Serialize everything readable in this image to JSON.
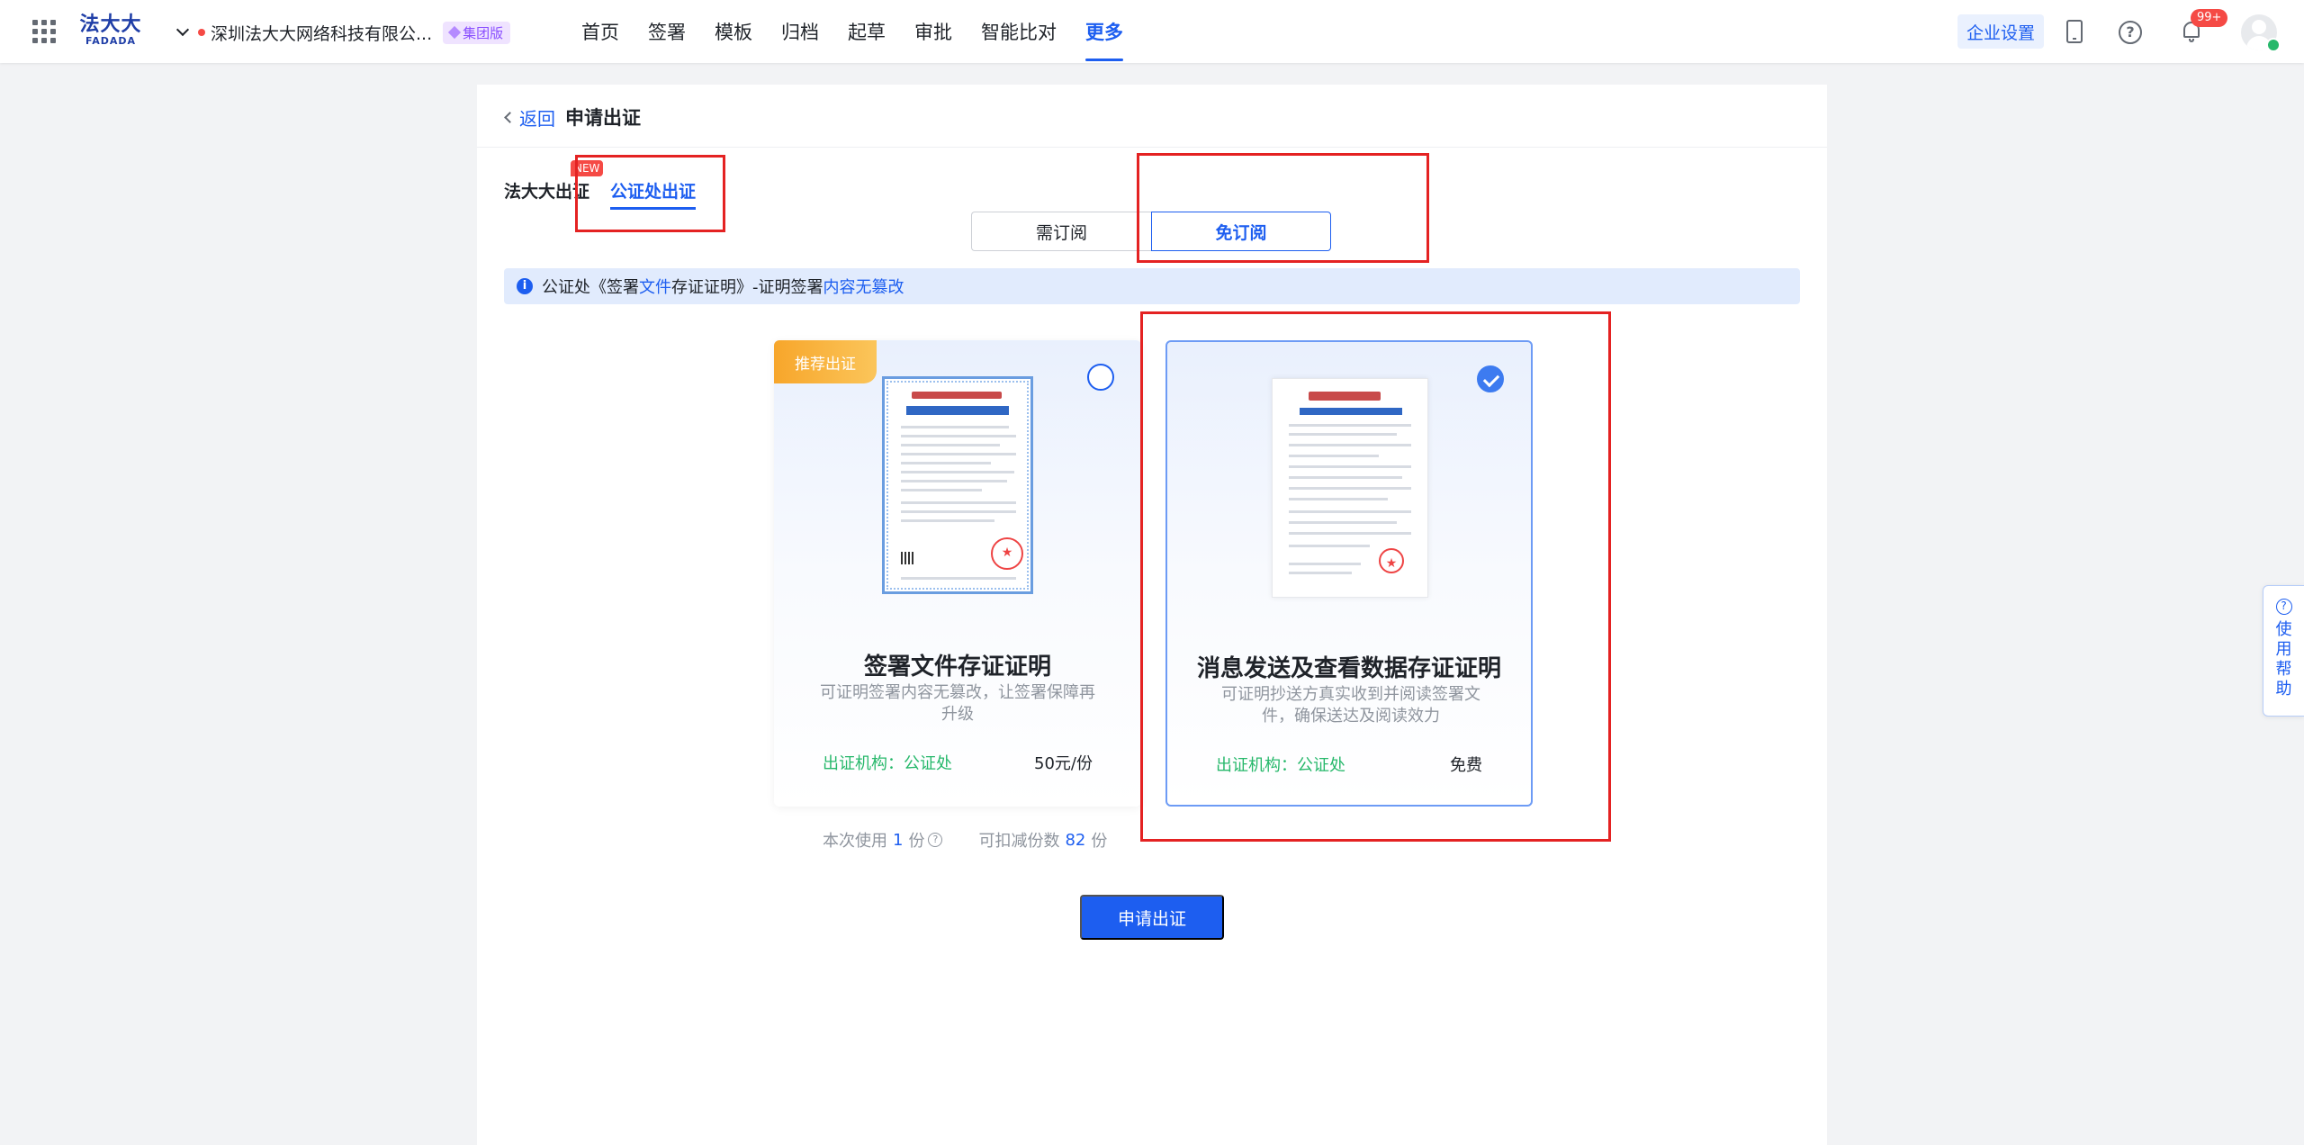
{
  "topbar": {
    "logo_cn": "法大大",
    "logo_en": "FADADA",
    "company": "深圳法大大网络科技有限公...",
    "edition_badge": "集团版",
    "nav": [
      "首页",
      "签署",
      "模板",
      "归档",
      "起草",
      "审批",
      "智能比对",
      "更多"
    ],
    "active_nav": "更多",
    "enterprise_settings": "企业设置",
    "bell_count": "99+",
    "help_glyph": "?"
  },
  "page": {
    "back": "返回",
    "title": "申请出证",
    "tabs": {
      "fadada": "法大大出证",
      "new_badge": "NEW",
      "notary": "公证处出证"
    },
    "subscription": {
      "need": "需订阅",
      "free": "免订阅"
    },
    "info": {
      "icon": "i",
      "prefix": "公证处《签署",
      "hl1": "文件",
      "mid": "存证证明》-证明签署",
      "hl2": "内容无篡改"
    },
    "cards": [
      {
        "tag": "推荐出证",
        "title": "签署文件存证证明",
        "desc": "可证明签署内容无篡改，让签署保障再升级",
        "org": "出证机构：公证处",
        "price": "50元/份",
        "selected": false
      },
      {
        "title": "消息发送及查看数据存证证明",
        "desc": "可证明抄送方真实收到并阅读签署文件，确保送达及阅读效力",
        "org": "出证机构：公证处",
        "price": "免费",
        "selected": true
      }
    ],
    "usage": {
      "label1": "本次使用",
      "count1": "1",
      "unit1": "份",
      "q": "?",
      "label2": "可扣减份数",
      "count2": "82",
      "unit2": "份"
    },
    "submit": "申请出证"
  },
  "help_float": {
    "icon": "?",
    "label": "使用帮助"
  },
  "colors": {
    "primary": "#1d5ef0",
    "annotation": "#e42222",
    "org_green": "#27b86b"
  }
}
